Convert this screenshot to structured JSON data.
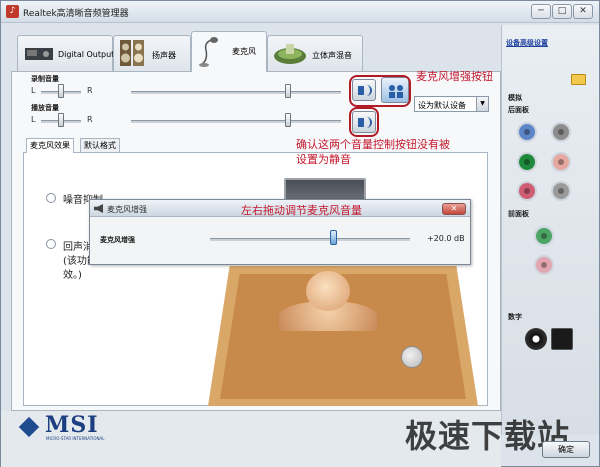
{
  "window": {
    "title": "Realtek高清晰音频管理器",
    "min_label": "─",
    "max_label": "□",
    "close_label": "✕"
  },
  "device_tabs": [
    {
      "label": "Digital Output",
      "icon": "digital-output-icon"
    },
    {
      "label": "扬声器",
      "icon": "speaker-icon"
    },
    {
      "label": "麦克风",
      "icon": "microphone-icon"
    },
    {
      "label": "立体声混音",
      "icon": "stereo-mix-icon"
    }
  ],
  "controls": {
    "record_volume_label": "录制音量",
    "playback_volume_label": "播放音量",
    "left": "L",
    "right": "R",
    "default_device": "设为默认设备",
    "mute_icon": "speaker-mute-icon",
    "boost_icon": "microphone-boost-icon"
  },
  "sub_tabs": [
    "麦克风效果",
    "默认格式"
  ],
  "options": {
    "noise_suppression": "噪音抑制",
    "echo_cancel_line1": "回声消",
    "echo_cancel_line2": "(该功能",
    "echo_cancel_line3": "效。)"
  },
  "popup": {
    "title": "麦克风增强",
    "close_label": "✕",
    "boost_label": "麦克风增强",
    "boost_value": "+20.0 dB",
    "boost_level_db": 20
  },
  "annotations": {
    "boost_button": "麦克风增强按钮",
    "check_line1": "确认这两个音量控制按钮没有被",
    "check_line2": "设置为静音",
    "drag_hint": "左右拖动调节麦克风音量",
    "color": "#c3192d"
  },
  "right_panel": {
    "advanced_link": "设备高级设置",
    "analog_label": "模拟",
    "rear_label": "后面板",
    "front_label": "前面板",
    "digital_label": "数字",
    "folder_icon": "folder-icon",
    "jacks_rear": [
      {
        "color": "#5d86c8",
        "name": "jack-rear-blue"
      },
      {
        "color": "#8d8d8d",
        "name": "jack-rear-gray-1"
      },
      {
        "color": "#1f8a3c",
        "name": "jack-rear-green"
      },
      {
        "color": "#e7a8a0",
        "name": "jack-rear-pink"
      },
      {
        "color": "#cf5e74",
        "name": "jack-rear-red"
      },
      {
        "color": "#9a9a9a",
        "name": "jack-rear-gray-2"
      }
    ],
    "jacks_front": [
      {
        "color": "#4da566",
        "name": "jack-front-green"
      },
      {
        "color": "#e2a6b3",
        "name": "jack-front-pink"
      }
    ]
  },
  "footer": {
    "brand": "MSI",
    "brand_sub": "MICRO-STAR INTERNATIONAL",
    "ok_label": "确定",
    "watermark": "极速下载站"
  }
}
